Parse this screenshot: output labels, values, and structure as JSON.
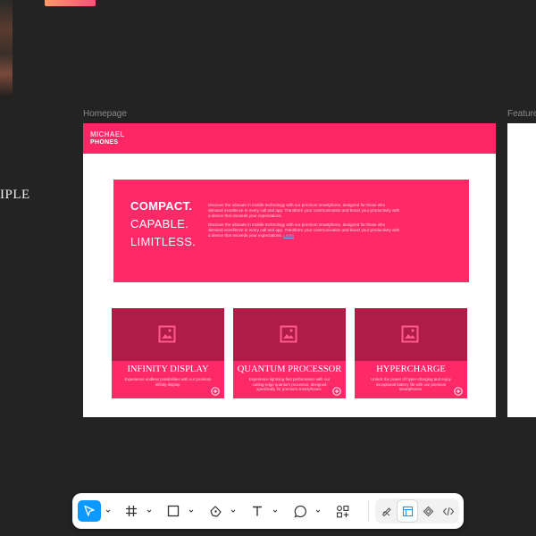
{
  "canvas": {
    "left_fragment_text": "IPLE",
    "frames": {
      "homepage_label": "Homepage",
      "feature_label": "Feature"
    }
  },
  "homepage": {
    "brand_line1": "MICHAEL",
    "brand_line2": "PHONES",
    "hero": {
      "headline1": "COMPACT.",
      "headline2": "CAPABLE.",
      "headline3": "LIMITLESS.",
      "paragraph1": "Discover the ultimate in mobile technology with our premium smartphone, designed for those who demand excellence in every call and app. Transform your communication and boost your productivity with a device that exceeds your expectations.",
      "paragraph2": "Discover the ultimate in mobile technology with our premium smartphone, designed for those who demand excellence in every call and app. Transform your communication and boost your productivity with a device that exceeds your expectations.",
      "link_text": "Learn"
    },
    "cards": [
      {
        "title": "INFINITY DISPLAY",
        "desc": "Experience endless possibilities with our premium infinity display."
      },
      {
        "title": "QUANTUM PROCESSOR",
        "desc": "Experience lightning-fast performance with our cutting-edge quantum processor, designed specifically for premium smartphones."
      },
      {
        "title": "HYPERCHARGE",
        "desc": "Unlock the power of hyper-charging and enjoy exceptional battery life with our premium smartphones."
      }
    ]
  },
  "toolbar": {
    "tools": [
      "move-tool",
      "frame-tool",
      "shape-tool",
      "pen-tool",
      "text-tool",
      "comment-tool",
      "actions-tool"
    ],
    "right_tools": [
      "draw-mode",
      "design-mode",
      "prototype-mode",
      "dev-mode"
    ]
  },
  "colors": {
    "accent": "#fd2766",
    "card_image": "#b01c48",
    "canvas_bg": "#232323",
    "selected_tool": "#0d99ff"
  }
}
